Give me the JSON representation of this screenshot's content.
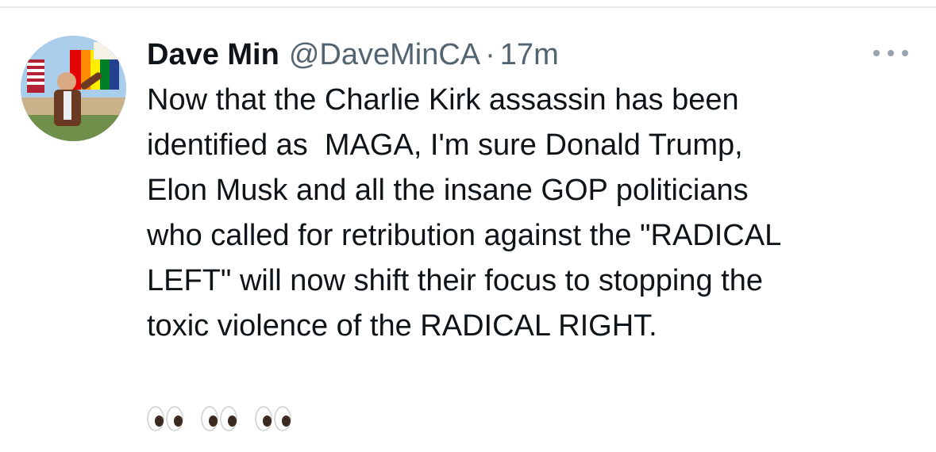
{
  "author": {
    "display_name": "Dave Min",
    "handle": "@DaveMinCA",
    "separator": "·",
    "timestamp": "17m",
    "avatar_icon": "profile-photo"
  },
  "actions": {
    "more_icon": "more-horizontal-icon"
  },
  "tweet": {
    "text": "Now that the Charlie Kirk assassin has been\nidentified as  MAGA, I'm sure Donald Trump,\nElon Musk and all the insane GOP politicians\nwho called for retribution against the \"RADICAL\nLEFT\" will now shift their focus to stopping the\ntoxic violence of the RADICAL RIGHT.",
    "emoji": [
      "eyes-emoji",
      "eyes-emoji",
      "eyes-emoji"
    ]
  },
  "colors": {
    "text_primary": "#0f1419",
    "text_secondary": "#536471",
    "divider": "#e6e9ec"
  }
}
